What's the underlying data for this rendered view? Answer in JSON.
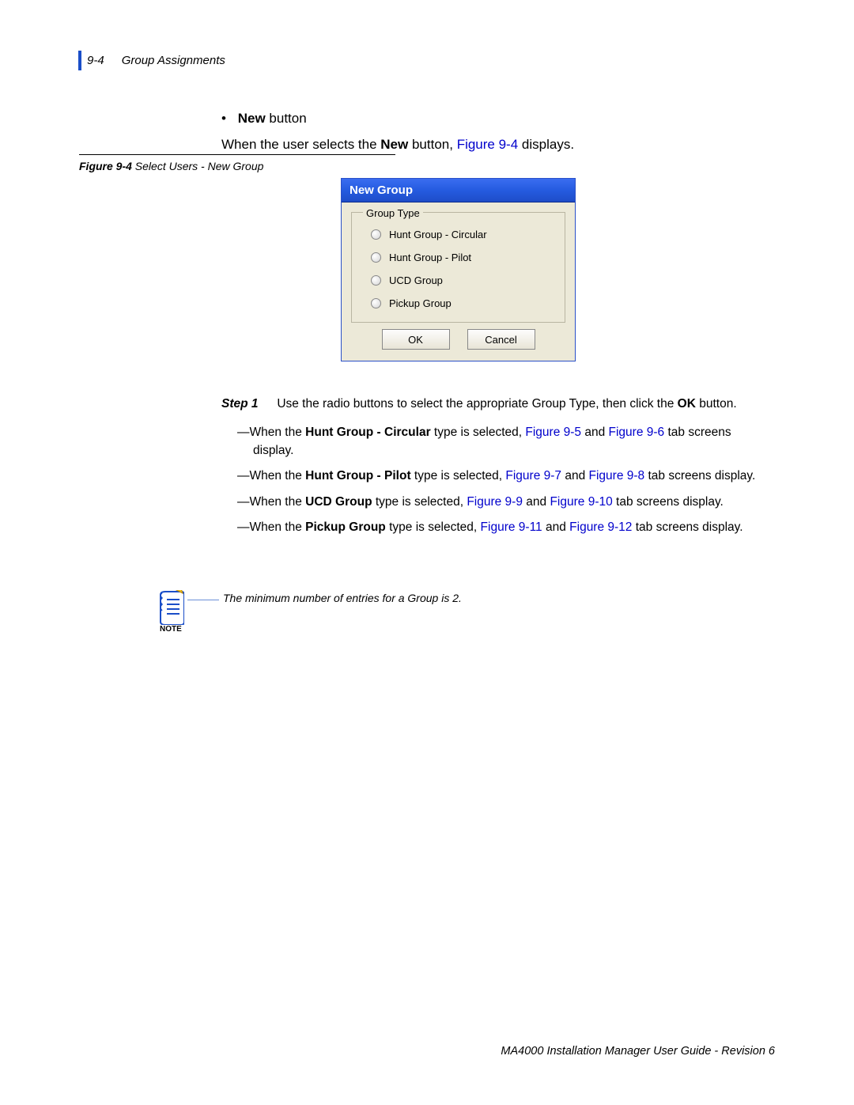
{
  "header": {
    "pgnum": "9-4",
    "title": "Group Assignments"
  },
  "intro": {
    "bullet_label_bold": "New",
    "bullet_label_rest": " button",
    "desc_pre": "When the user selects the ",
    "desc_bold": "New",
    "desc_mid": " button, ",
    "desc_link": "Figure 9-4",
    "desc_post": " displays."
  },
  "figcap": {
    "label": "Figure 9-4",
    "text": "  Select Users - New Group"
  },
  "dialog": {
    "title": "New Group",
    "legend": "Group Type",
    "options": [
      "Hunt Group - Circular",
      "Hunt Group - Pilot",
      "UCD Group",
      "Pickup Group"
    ],
    "ok": "OK",
    "cancel": "Cancel"
  },
  "step": {
    "label": "Step  1",
    "text_pre": "Use the radio buttons to select the appropriate Group Type, then click the ",
    "text_bold": "OK",
    "text_post": " button.",
    "items": [
      {
        "pre": "—When the ",
        "bold": "Hunt Group - Circular",
        "mid": " type is selected, ",
        "link1": "Figure 9-5",
        "mid2": " and ",
        "link2": "Figure 9-6",
        "post": " tab screens display."
      },
      {
        "pre": "—When the ",
        "bold": "Hunt Group - Pilot",
        "mid": " type is selected, ",
        "link1": "Figure 9-7",
        "mid2": " and ",
        "link2": "Figure 9-8",
        "post": " tab screens display."
      },
      {
        "pre": "—When the ",
        "bold": "UCD Group",
        "mid": " type is selected, ",
        "link1": "Figure 9-9",
        "mid2": " and ",
        "link2": "Figure 9-10",
        "post": " tab screens display."
      },
      {
        "pre": "—When the ",
        "bold": "Pickup Group",
        "mid": " type is selected, ",
        "link1": "Figure 9-11",
        "mid2": " and ",
        "link2": "Figure 9-12",
        "post": " tab screens display."
      }
    ]
  },
  "note": {
    "label": "NOTE",
    "text": "The minimum number of entries for a Group is 2."
  },
  "footer": "MA4000 Installation Manager User Guide - Revision 6"
}
